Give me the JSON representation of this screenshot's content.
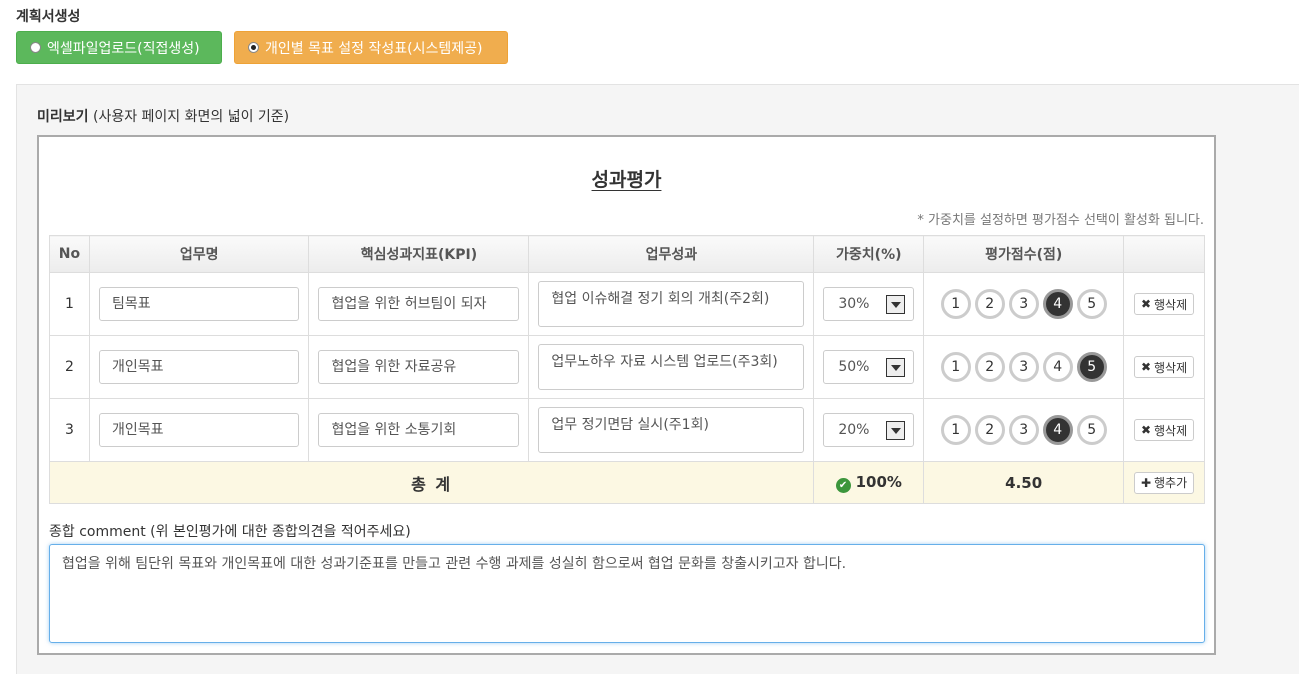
{
  "header": {
    "title": "계획서생성"
  },
  "modes": [
    {
      "label": "엑셀파일업로드(직접생성)",
      "checked": false,
      "color": "#5cb85c"
    },
    {
      "label": "개인별 목표 설정 작성표(시스템제공)",
      "checked": true,
      "color": "#f0ad4e"
    }
  ],
  "preview": {
    "label_bold": "미리보기",
    "label_rest": " (사용자 페이지 화면의 넓이 기준)",
    "doc_title": "성과평가",
    "hint": "* 가중치를 설정하면 평가점수 선택이 활성화 됩니다.",
    "columns": [
      "No",
      "업무명",
      "핵심성과지표(KPI)",
      "업무성과",
      "가중치(%)",
      "평가점수(점)",
      ""
    ],
    "rows": [
      {
        "no": "1",
        "task": "팀목표",
        "kpi": "협업을 위한 허브팀이 되자",
        "result": "협업 이슈해결 정기 회의 개최(주2회)",
        "weight": "30%",
        "score": 4
      },
      {
        "no": "2",
        "task": "개인목표",
        "kpi": "협업을 위한 자료공유",
        "result": "업무노하우 자료 시스템 업로드(주3회)",
        "weight": "50%",
        "score": 5
      },
      {
        "no": "3",
        "task": "개인목표",
        "kpi": "협업을 위한 소통기회",
        "result": "업무 정기면담 실시(주1회)",
        "weight": "20%",
        "score": 4
      }
    ],
    "score_options": [
      "1",
      "2",
      "3",
      "4",
      "5"
    ],
    "delete_label": "행삭제",
    "total": {
      "label": "총 계",
      "weight": "100%",
      "score": "4.50",
      "add_label": "행추가"
    },
    "comment_label": "종합 comment (위 본인평가에 대한 종합의견을 적어주세요)",
    "comment_text": "협업을 위해 팀단위 목표와 개인목표에 대한 성과기준표를 만들고 관련 수행 과제를 성실히 함으로써 협업 문화를 창출시키고자 합니다."
  }
}
